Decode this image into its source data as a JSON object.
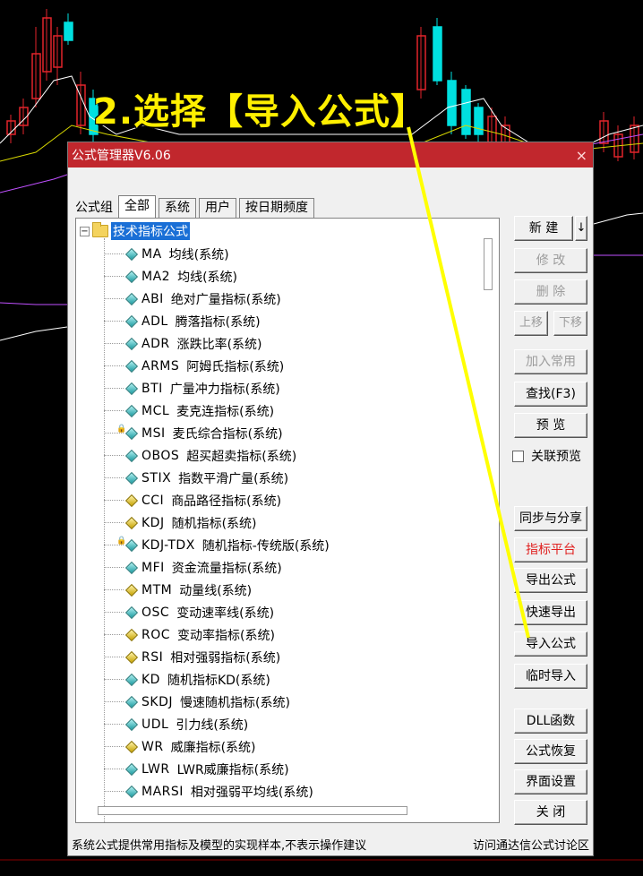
{
  "caption": "2.选择【导入公式】",
  "dialog": {
    "title": "公式管理器V6.06",
    "close_icon": "×",
    "tab_label": "公式组",
    "tabs": [
      "全部",
      "系统",
      "用户",
      "按日期频度"
    ],
    "active_tab": "全部",
    "root": "技术指标公式",
    "root_expander": "−",
    "items": [
      {
        "code": "MA",
        "name": "均线(系统)",
        "icon": "teal",
        "lock": false
      },
      {
        "code": "MA2",
        "name": "均线(系统)",
        "icon": "teal",
        "lock": false
      },
      {
        "code": "ABI",
        "name": "绝对广量指标(系统)",
        "icon": "teal",
        "lock": false
      },
      {
        "code": "ADL",
        "name": "腾落指标(系统)",
        "icon": "teal",
        "lock": false
      },
      {
        "code": "ADR",
        "name": "涨跌比率(系统)",
        "icon": "teal",
        "lock": false
      },
      {
        "code": "ARMS",
        "name": "阿姆氏指标(系统)",
        "icon": "teal",
        "lock": false
      },
      {
        "code": "BTI",
        "name": "广量冲力指标(系统)",
        "icon": "teal",
        "lock": false
      },
      {
        "code": "MCL",
        "name": "麦克连指标(系统)",
        "icon": "teal",
        "lock": false
      },
      {
        "code": "MSI",
        "name": "麦氏综合指标(系统)",
        "icon": "teal",
        "lock": true
      },
      {
        "code": "OBOS",
        "name": "超买超卖指标(系统)",
        "icon": "teal",
        "lock": false
      },
      {
        "code": "STIX",
        "name": "指数平滑广量(系统)",
        "icon": "teal",
        "lock": false
      },
      {
        "code": "CCI",
        "name": "商品路径指标(系统)",
        "icon": "yellow",
        "lock": false
      },
      {
        "code": "KDJ",
        "name": "随机指标(系统)",
        "icon": "yellow",
        "lock": false
      },
      {
        "code": "KDJ-TDX",
        "name": "随机指标-传统版(系统)",
        "icon": "teal",
        "lock": true
      },
      {
        "code": "MFI",
        "name": "资金流量指标(系统)",
        "icon": "teal",
        "lock": false
      },
      {
        "code": "MTM",
        "name": "动量线(系统)",
        "icon": "yellow",
        "lock": false
      },
      {
        "code": "OSC",
        "name": "变动速率线(系统)",
        "icon": "teal",
        "lock": false
      },
      {
        "code": "ROC",
        "name": "变动率指标(系统)",
        "icon": "yellow",
        "lock": false
      },
      {
        "code": "RSI",
        "name": "相对强弱指标(系统)",
        "icon": "yellow",
        "lock": false
      },
      {
        "code": "KD",
        "name": "随机指标KD(系统)",
        "icon": "teal",
        "lock": false
      },
      {
        "code": "SKDJ",
        "name": "慢速随机指标(系统)",
        "icon": "teal",
        "lock": false
      },
      {
        "code": "UDL",
        "name": "引力线(系统)",
        "icon": "teal",
        "lock": false
      },
      {
        "code": "WR",
        "name": "威廉指标(系统)",
        "icon": "yellow",
        "lock": false
      },
      {
        "code": "LWR",
        "name": "LWR威廉指标(系统)",
        "icon": "teal",
        "lock": false
      },
      {
        "code": "MARSI",
        "name": "相对强弱平均线(系统)",
        "icon": "teal",
        "lock": false
      }
    ],
    "buttons": {
      "new": "新 建",
      "new_arrow": "↓",
      "modify": "修 改",
      "delete": "删 除",
      "move_up": "上移",
      "move_down": "下移",
      "add_common": "加入常用",
      "find": "查找(F3)",
      "preview": "预 览",
      "link_preview": "关联预览",
      "sync_share": "同步与分享",
      "indicator_platform": "指标平台",
      "export": "导出公式",
      "quick_export": "快速导出",
      "import": "导入公式",
      "temp_import": "临时导入",
      "dll": "DLL函数",
      "restore": "公式恢复",
      "ui_settings": "界面设置",
      "close": "关 闭"
    },
    "status_left": "系统公式提供常用指标及模型的实现样本,不表示操作建议",
    "status_right": "访问通达信公式讨论区"
  },
  "colors": {
    "titlebar": "#c1272d",
    "caption": "#ffef00",
    "arrow": "#ffff00",
    "up_candle": "#e3242b",
    "down_candle": "#00e0e0",
    "selection": "#1a6fd6"
  }
}
